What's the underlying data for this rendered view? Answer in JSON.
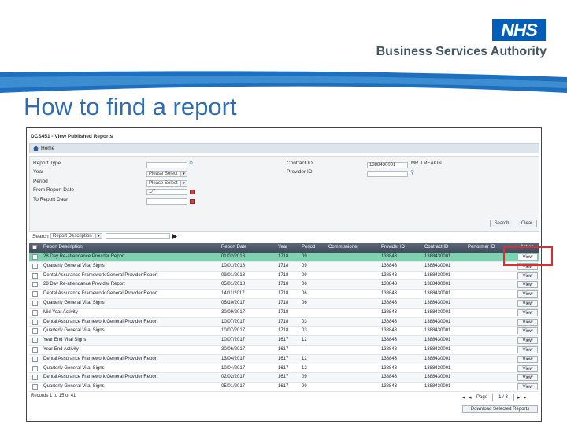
{
  "header": {
    "logo_text": "NHS",
    "org_name": "Business Services Authority",
    "slide_title": "How to find a report"
  },
  "app": {
    "window_title": "DCS451 - View Published Reports",
    "breadcrumb": "Home"
  },
  "filters": {
    "report_type_label": "Report Type",
    "year_label": "Year",
    "year_value": "Please Select",
    "period_label": "Period",
    "period_value": "Please Select",
    "from_date_label": "From Report Date",
    "from_date_value": "1/7",
    "to_date_label": "To Report Date",
    "contract_id_label": "Contract ID",
    "contract_id_value": "1388430001",
    "contract_name": "MR J MEAKIN",
    "provider_id_label": "Provider ID",
    "search_button": "Search",
    "clear_button": "Clear"
  },
  "quick_search": {
    "label": "Search",
    "select_value": "Report Description"
  },
  "table": {
    "columns": [
      "Report Description",
      "Report Date",
      "Year",
      "Period",
      "Commissioner",
      "Provider ID",
      "Contract ID",
      "Performer ID",
      "Action"
    ],
    "action_label": "View",
    "rows": [
      {
        "desc": "28 Day Re-attendance Provider Report",
        "date": "01/02/2018",
        "year": "1718",
        "period": "09",
        "provider": "138843",
        "contract": "1388430001"
      },
      {
        "desc": "Quarterly General Vital Signs",
        "date": "10/01/2018",
        "year": "1718",
        "period": "09",
        "provider": "138843",
        "contract": "1388430001"
      },
      {
        "desc": "Dental Assurance Framework General Provider Report",
        "date": "09/01/2018",
        "year": "1718",
        "period": "09",
        "provider": "138843",
        "contract": "1388430001"
      },
      {
        "desc": "28 Day Re-attendance Provider Report",
        "date": "05/01/2018",
        "year": "1718",
        "period": "06",
        "provider": "138843",
        "contract": "1388430001"
      },
      {
        "desc": "Dental Assurance Framework General Provider Report",
        "date": "14/11/2017",
        "year": "1718",
        "period": "06",
        "provider": "138843",
        "contract": "1388430001"
      },
      {
        "desc": "Quarterly General Vital Signs",
        "date": "06/10/2017",
        "year": "1718",
        "period": "06",
        "provider": "138843",
        "contract": "1388430001"
      },
      {
        "desc": "Mid Year Activity",
        "date": "30/09/2017",
        "year": "1718",
        "period": "",
        "provider": "138843",
        "contract": "1388430001"
      },
      {
        "desc": "Dental Assurance Framework General Provider Report",
        "date": "10/07/2017",
        "year": "1718",
        "period": "03",
        "provider": "138843",
        "contract": "1388430001"
      },
      {
        "desc": "Quarterly General Vital Signs",
        "date": "10/07/2017",
        "year": "1718",
        "period": "03",
        "provider": "138843",
        "contract": "1388430001"
      },
      {
        "desc": "Year End Vital Signs",
        "date": "10/07/2017",
        "year": "1617",
        "period": "12",
        "provider": "138843",
        "contract": "1388430001"
      },
      {
        "desc": "Year End Activity",
        "date": "30/06/2017",
        "year": "1617",
        "period": "",
        "provider": "138843",
        "contract": "1388430001"
      },
      {
        "desc": "Dental Assurance Framework General Provider Report",
        "date": "13/04/2017",
        "year": "1617",
        "period": "12",
        "provider": "138843",
        "contract": "1388430001"
      },
      {
        "desc": "Quarterly General Vital Signs",
        "date": "10/04/2017",
        "year": "1617",
        "period": "12",
        "provider": "138843",
        "contract": "1388430001"
      },
      {
        "desc": "Dental Assurance Framework General Provider Report",
        "date": "02/02/2017",
        "year": "1617",
        "period": "09",
        "provider": "138843",
        "contract": "1388430001"
      },
      {
        "desc": "Quarterly General Vital Signs",
        "date": "05/01/2017",
        "year": "1617",
        "period": "09",
        "provider": "138843",
        "contract": "1388430001"
      }
    ]
  },
  "footer": {
    "records_text": "Records 1 to 15 of 41",
    "page_label": "Page",
    "page_value": "1 / 3",
    "download_button": "Download Selected Reports"
  },
  "colors": {
    "nhs_blue": "#005eb8",
    "title_blue": "#2f6db0",
    "selected_row": "#7fd1b0",
    "header_bar": "#434c5e",
    "highlight_red": "#e22b2b"
  }
}
